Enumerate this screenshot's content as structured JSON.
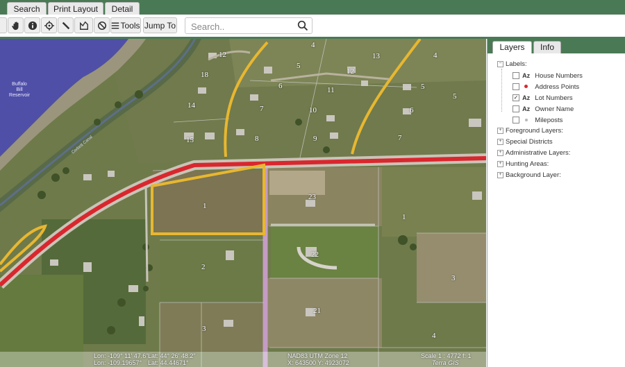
{
  "tabs": [
    {
      "label": "Search"
    },
    {
      "label": "Print Layout"
    },
    {
      "label": "Detail"
    }
  ],
  "toolbar": {
    "tools_label": "Tools",
    "jump_label": "Jump To",
    "search_placeholder": "Search.."
  },
  "map": {
    "water_label": [
      "Buffalo",
      "Bill",
      "Reservoir"
    ],
    "canal_label": "Corbett Canal",
    "lot_numbers": [
      "12",
      "4",
      "13",
      "4",
      "5",
      "12",
      "18",
      "5",
      "6",
      "11",
      "5",
      "14",
      "7",
      "10",
      "6",
      "15",
      "8",
      "9",
      "7",
      "1",
      "23",
      "1",
      "2",
      "22",
      "3",
      "21",
      "3",
      "4"
    ]
  },
  "coords": {
    "lon_dms": "Lon: -109° 11' 47.6\"",
    "lat_dms": "Lat: 44° 26' 48.2\"",
    "lon_dec": "Lon: -109.19657°",
    "lat_dec": "Lat: 44.44671°",
    "utm_zone": "NAD83 UTM Zone 12",
    "utm_xy": "X: 643500 Y: 4923072",
    "scale": "Scale 1 : 4772 f: 1",
    "credit": "Terra GIS"
  },
  "panel": {
    "tabs": [
      {
        "label": "Layers"
      },
      {
        "label": "Info"
      }
    ],
    "labels_group": "Labels:",
    "label_items": [
      {
        "name": "House Numbers",
        "checked": false,
        "marker": "Az"
      },
      {
        "name": "Address Points",
        "checked": false,
        "marker": "dot",
        "color": "#d9272e"
      },
      {
        "name": "Lot Numbers",
        "checked": true,
        "marker": "Az"
      },
      {
        "name": "Owner Name",
        "checked": false,
        "marker": "Az"
      },
      {
        "name": "Mileposts",
        "checked": false,
        "marker": "dot",
        "color": "#b8b8b8"
      }
    ],
    "groups": [
      "Foreground Layers:",
      "Special Districts",
      "Administrative Layers:",
      "Hunting Areas:",
      "Background Layer:"
    ]
  },
  "colors": {
    "header_green": "#4a7a55",
    "highway_red": "#d9272e",
    "road_yellow": "#e8b730"
  }
}
